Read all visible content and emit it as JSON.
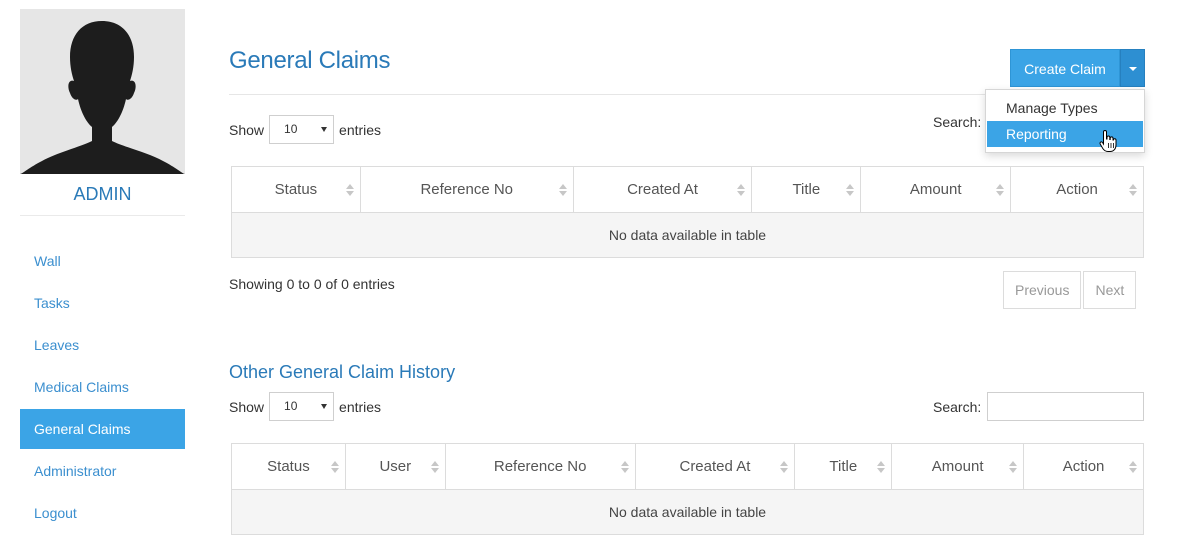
{
  "sidebar": {
    "username": "ADMIN",
    "items": [
      {
        "label": "Wall",
        "active": false
      },
      {
        "label": "Tasks",
        "active": false
      },
      {
        "label": "Leaves",
        "active": false
      },
      {
        "label": "Medical Claims",
        "active": false
      },
      {
        "label": "General Claims",
        "active": true
      },
      {
        "label": "Administrator",
        "active": false
      },
      {
        "label": "Logout",
        "active": false
      }
    ]
  },
  "main": {
    "title": "General Claims",
    "create_button": "Create Claim",
    "dropdown": {
      "items": [
        {
          "label": "Manage Types",
          "highlighted": false
        },
        {
          "label": "Reporting",
          "highlighted": true
        }
      ]
    },
    "table1": {
      "show_label": "Show",
      "entries_label": "entries",
      "length_value": "10",
      "search_label": "Search:",
      "columns": [
        "Status",
        "Reference No",
        "Created At",
        "Title",
        "Amount",
        "Action"
      ],
      "empty_message": "No data available in table",
      "info": "Showing 0 to 0 of 0 entries",
      "prev": "Previous",
      "next": "Next"
    },
    "section2_title": "Other General Claim History",
    "table2": {
      "show_label": "Show",
      "entries_label": "entries",
      "length_value": "10",
      "search_label": "Search:",
      "columns": [
        "Status",
        "User",
        "Reference No",
        "Created At",
        "Title",
        "Amount",
        "Action"
      ],
      "empty_message": "No data available in table"
    }
  },
  "colors": {
    "accent": "#3ba4e6",
    "title_blue": "#2a7ab8",
    "link_blue": "#3b8fcf"
  }
}
